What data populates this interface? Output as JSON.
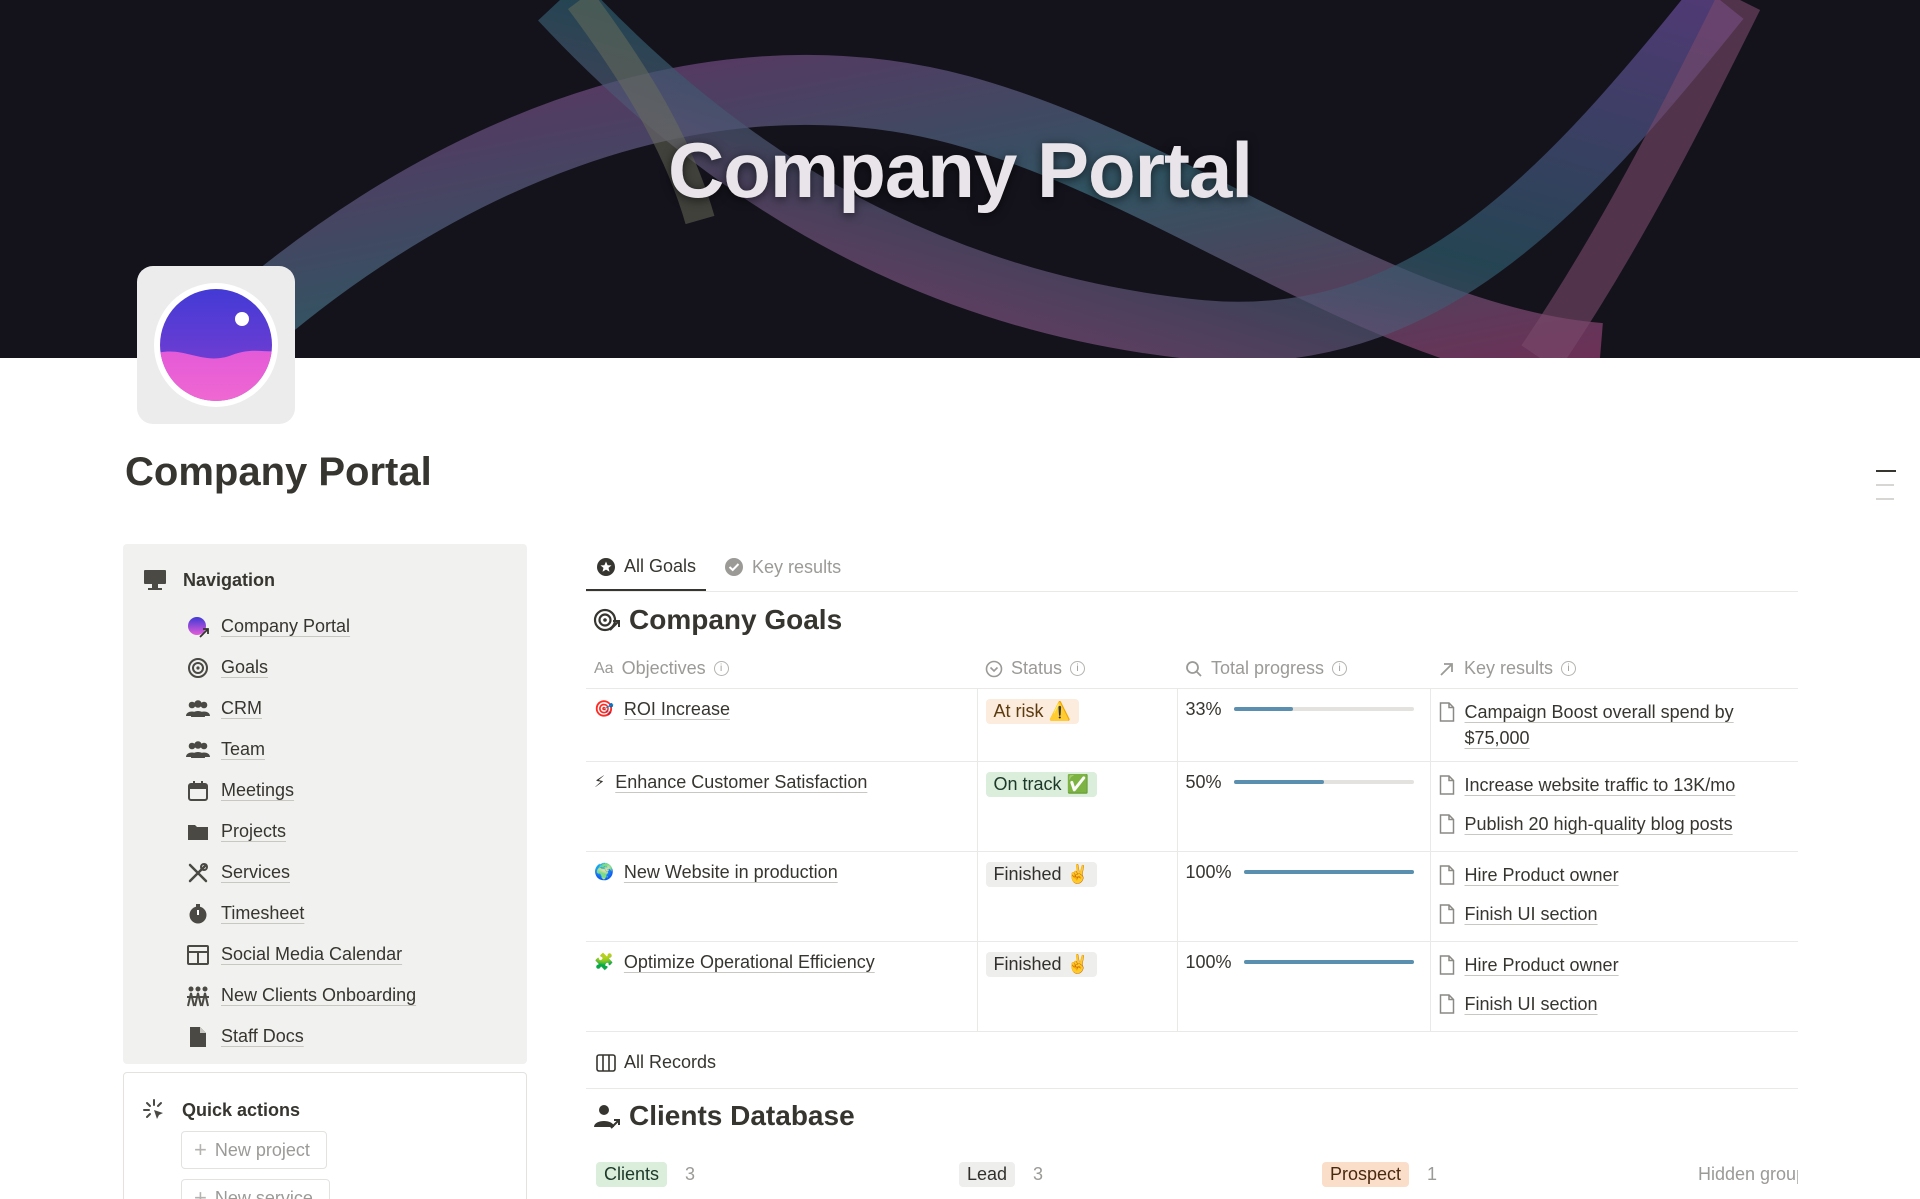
{
  "cover": {
    "title": "Company Portal"
  },
  "page": {
    "title": "Company Portal"
  },
  "navigation": {
    "title": "Navigation",
    "items": [
      {
        "label": "Company Portal",
        "icon": "company-portal-link-icon"
      },
      {
        "label": "Goals",
        "icon": "target-icon"
      },
      {
        "label": "CRM",
        "icon": "people-icon"
      },
      {
        "label": "Team",
        "icon": "people-icon"
      },
      {
        "label": "Meetings",
        "icon": "calendar-icon"
      },
      {
        "label": "Projects",
        "icon": "folder-icon"
      },
      {
        "label": "Services",
        "icon": "tools-icon"
      },
      {
        "label": "Timesheet",
        "icon": "stopwatch-icon"
      },
      {
        "label": "Social Media Calendar",
        "icon": "layout-icon"
      },
      {
        "label": "New Clients Onboarding",
        "icon": "group-icon"
      },
      {
        "label": "Staff Docs",
        "icon": "document-icon"
      }
    ]
  },
  "quick_actions": {
    "title": "Quick actions",
    "buttons": [
      "New project",
      "New service"
    ]
  },
  "goals_tabs": [
    {
      "label": "All Goals",
      "active": true
    },
    {
      "label": "Key results",
      "active": false
    }
  ],
  "company_goals": {
    "title": "Company Goals",
    "columns": {
      "objectives": "Objectives",
      "status": "Status",
      "progress": "Total progress",
      "key_results": "Key results"
    },
    "rows": [
      {
        "icon": "🎯",
        "objective": "ROI Increase",
        "status": "At risk ⚠️",
        "status_bg": "#fbecdd",
        "status_color": "#5c3b0e",
        "progress_label": "33%",
        "progress": 0.33,
        "key_results": [
          "Campaign Boost overall spend by $75,000"
        ]
      },
      {
        "icon": "⚡",
        "objective": "Enhance Customer Satisfaction",
        "status": "On track ✅",
        "status_bg": "#dbeddb",
        "status_color": "#1c3829",
        "progress_label": "50%",
        "progress": 0.5,
        "key_results": [
          "Increase website traffic to 13K/mo",
          "Publish 20 high-quality blog posts"
        ]
      },
      {
        "icon": "🌍",
        "objective": "New Website in production",
        "status": "Finished ✌️",
        "status_bg": "#eeeeed",
        "status_color": "#32302c",
        "progress_label": "100%",
        "progress": 1.0,
        "key_results": [
          "Hire Product owner",
          "Finish UI section"
        ]
      },
      {
        "icon": "🧩",
        "objective": "Optimize Operational Efficiency",
        "status": "Finished ✌️",
        "status_bg": "#eeeeed",
        "status_color": "#32302c",
        "progress_label": "100%",
        "progress": 1.0,
        "key_results": [
          "Hire Product owner",
          "Finish UI section"
        ]
      }
    ]
  },
  "records_tab": {
    "label": "All Records"
  },
  "clients_db": {
    "title": "Clients Database",
    "groups": [
      {
        "label": "Clients",
        "count": "3",
        "bg": "#dbeddb",
        "color": "#1c3829"
      },
      {
        "label": "Lead",
        "count": "3",
        "bg": "#eeeeed",
        "color": "#32302c"
      },
      {
        "label": "Prospect",
        "count": "1",
        "bg": "#fadec9",
        "color": "#49290e"
      }
    ],
    "hidden_groups": "Hidden groups"
  },
  "colors": {
    "accent_bar": "#5b8fb0",
    "sidebar_bg": "#f1f1ef",
    "text": "#37352f",
    "muted": "#9b9a97"
  }
}
